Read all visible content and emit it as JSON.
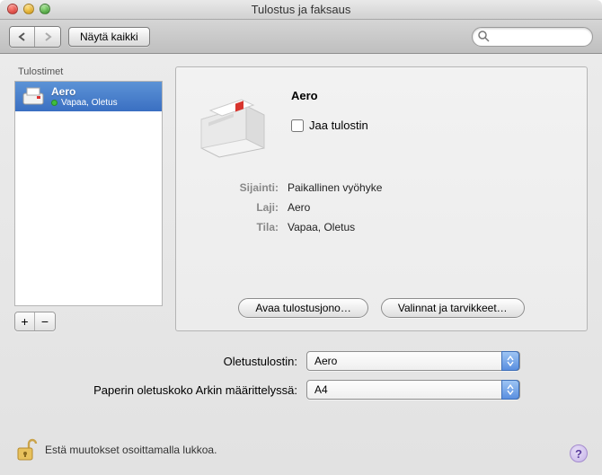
{
  "window": {
    "title": "Tulostus ja faksaus"
  },
  "toolbar": {
    "show_all": "Näytä kaikki",
    "search_placeholder": ""
  },
  "sidebar": {
    "header": "Tulostimet",
    "items": [
      {
        "name": "Aero",
        "status": "Vapaa, Oletus"
      }
    ]
  },
  "detail": {
    "name": "Aero",
    "share_label": "Jaa tulostin",
    "location_key": "Sijainti:",
    "location_val": "Paikallinen vyöhyke",
    "kind_key": "Laji:",
    "kind_val": "Aero",
    "state_key": "Tila:",
    "state_val": "Vapaa, Oletus",
    "open_queue": "Avaa tulostusjono…",
    "options": "Valinnat ja tarvikkeet…"
  },
  "form": {
    "default_printer_label": "Oletustulostin:",
    "default_printer_value": "Aero",
    "paper_label": "Paperin oletuskoko Arkin määrittelyssä:",
    "paper_value": "A4"
  },
  "lock": {
    "text": "Estä muutokset osoittamalla lukkoa."
  },
  "help": {
    "glyph": "?"
  },
  "glyphs": {
    "plus": "+",
    "minus": "−"
  }
}
